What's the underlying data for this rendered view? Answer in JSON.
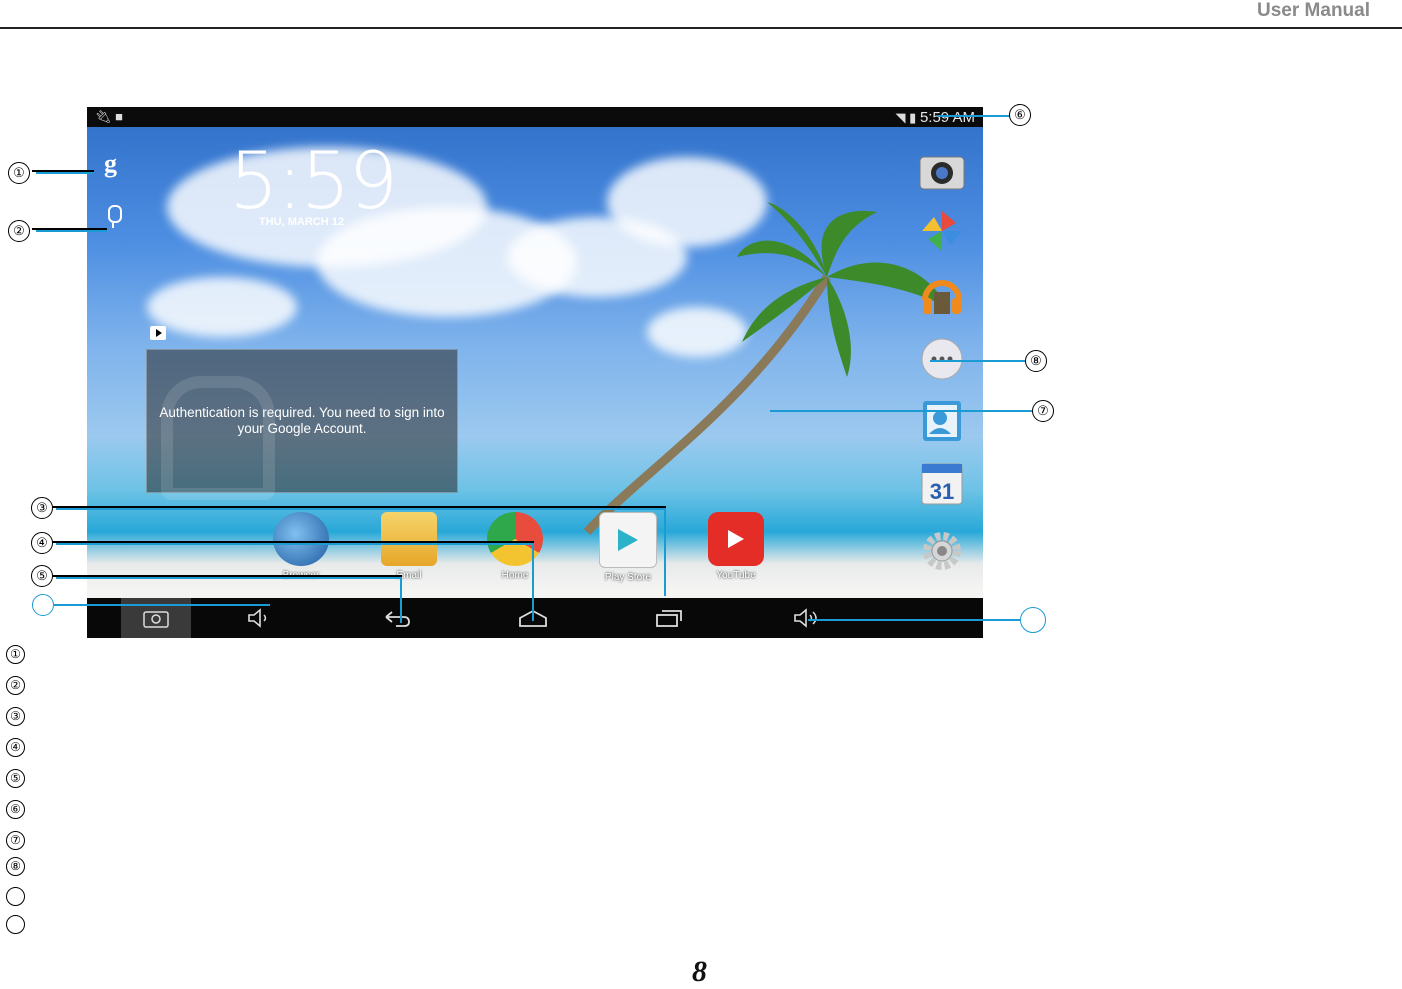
{
  "header": {
    "title": "User Manual"
  },
  "screen": {
    "status_time": "5:59 AM",
    "clock_time": "5:59",
    "clock_date": "THU, MARCH 12",
    "widget_message": "Authentication is required. You need to sign into your Google Account.",
    "google_label": "g",
    "apps": [
      {
        "label": "Browser",
        "color": "#2a6fb0"
      },
      {
        "label": "Email",
        "color": "#f0c040"
      },
      {
        "label": "Home",
        "color": "#d8d8d8"
      },
      {
        "label": "Play Store",
        "color": "#f4f4f4"
      },
      {
        "label": "YouTube",
        "color": "#e52d27"
      }
    ],
    "calendar_day": "31",
    "right_icons": [
      "camera-icon",
      "photos-icon",
      "music-icon",
      "all-apps-icon",
      "contacts-icon",
      "calendar-icon",
      "settings-icon"
    ]
  },
  "callouts": {
    "n1": "①",
    "n2": "②",
    "n3": "③",
    "n4": "④",
    "n5": "⑤",
    "n6": "⑥",
    "n7": "⑦",
    "n8": "⑧"
  },
  "legend": [
    "①",
    "②",
    "③",
    "④",
    "⑤",
    "⑥",
    "⑦",
    "⑧"
  ],
  "page": {
    "number": "8"
  }
}
